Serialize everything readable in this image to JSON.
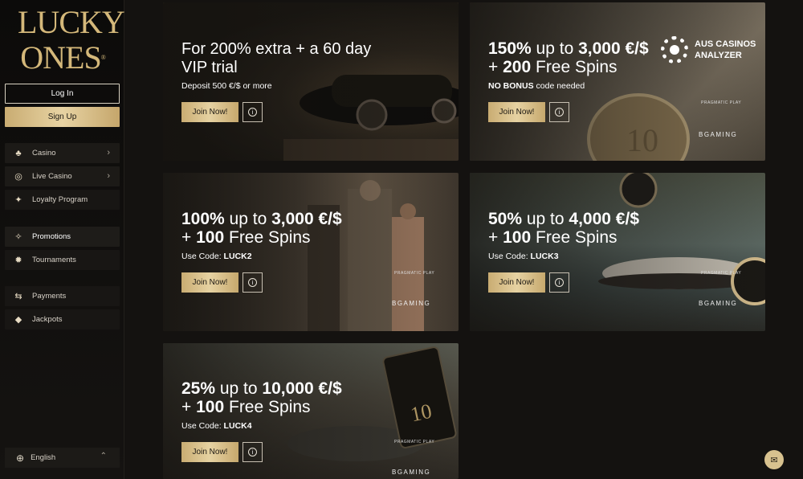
{
  "brand": {
    "line1": "LUCKY",
    "line2": "ONES",
    "reg": "®"
  },
  "auth": {
    "login": "Log In",
    "signup": "Sign Up"
  },
  "nav": [
    {
      "label": "Casino",
      "icon": "cherries-icon",
      "glyph": "♣",
      "chevron": "›"
    },
    {
      "label": "Live Casino",
      "icon": "live-chip-icon",
      "glyph": "◎",
      "chevron": "›"
    },
    {
      "label": "Loyalty Program",
      "icon": "sparkle-icon",
      "glyph": "✦"
    },
    {
      "label": "Promotions",
      "icon": "party-popper-icon",
      "glyph": "✧"
    },
    {
      "label": "Tournaments",
      "icon": "medal-icon",
      "glyph": "✹"
    },
    {
      "label": "Payments",
      "icon": "transfer-arrows-icon",
      "glyph": "⇆"
    },
    {
      "label": "Jackpots",
      "icon": "diamond-icon",
      "glyph": "◆"
    }
  ],
  "language": {
    "label": "English",
    "icon": "globe-icon",
    "glyph": "⊕",
    "chevron": "⌃"
  },
  "promos": [
    {
      "title_pre": "For 200% extra + a 60 day VIP trial",
      "sub_pre": "Deposit 500 €/$ or more",
      "sub_code": "",
      "join": "Join Now!",
      "info": "i"
    },
    {
      "title_big": "150%",
      "title_mid": " up to ",
      "title_amount": "3,000 €/$",
      "title_spins_pre": "+ ",
      "title_spins_num": "200",
      "title_spins": " Free Spins",
      "sub_pre": "",
      "sub_code": "NO BONUS",
      "sub_post": " code needed",
      "join": "Join Now!",
      "info": "i",
      "brand1": "PRAGMATIC PLAY",
      "brand2": "BGAMING"
    },
    {
      "title_big": "100%",
      "title_mid": " up to ",
      "title_amount": "3,000 €/$",
      "title_spins_pre": "+ ",
      "title_spins_num": "100",
      "title_spins": " Free Spins",
      "sub_pre": "Use Code: ",
      "sub_code": "LUCK2",
      "join": "Join Now!",
      "info": "i",
      "brand1": "PRAGMATIC PLAY",
      "brand2": "BGAMING"
    },
    {
      "title_big": "50%",
      "title_mid": " up to ",
      "title_amount": "4,000 €/$",
      "title_spins_pre": "+ ",
      "title_spins_num": "100",
      "title_spins": " Free Spins",
      "sub_pre": "Use Code: ",
      "sub_code": "LUCK3",
      "join": "Join Now!",
      "info": "i",
      "brand1": "PRAGMATIC PLAY",
      "brand2": "BGAMING"
    },
    {
      "title_big": "25%",
      "title_mid": " up to ",
      "title_amount": "10,000 €/$",
      "title_spins_pre": "+ ",
      "title_spins_num": "100",
      "title_spins": " Free Spins",
      "sub_pre": "Use Code: ",
      "sub_code": "LUCK4",
      "join": "Join Now!",
      "info": "i",
      "brand1": "PRAGMATIC PLAY",
      "brand2": "BGAMING"
    }
  ],
  "watermark": {
    "line1": "AUS CASINOS",
    "line2": "ANALYZER"
  },
  "chat": {
    "icon": "chat-icon",
    "glyph": "✉"
  },
  "colors": {
    "gold": "#d4b87a",
    "button_gold": "#e6d2a2",
    "background": "#141210"
  }
}
